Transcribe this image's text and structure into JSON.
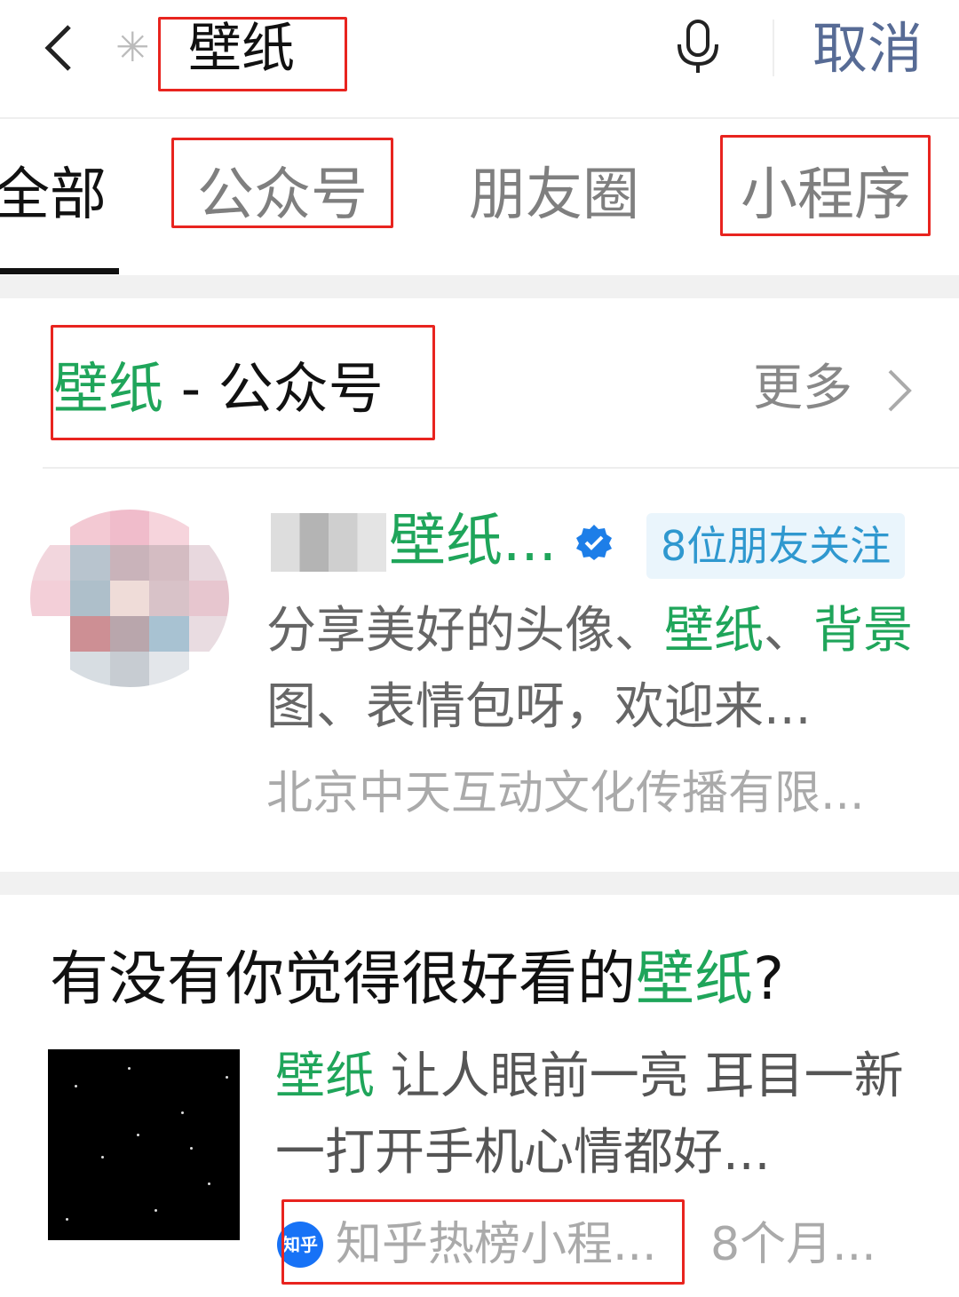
{
  "search_bar": {
    "back_icon": "chevron-left-icon",
    "scan_icon": "loading-spinner-icon",
    "query": "壁纸",
    "mic_icon": "microphone-icon",
    "cancel_label": "取消"
  },
  "tabs": [
    {
      "label": "全部",
      "active": true
    },
    {
      "label": "公众号",
      "active": false
    },
    {
      "label": "朋友圈",
      "active": false
    },
    {
      "label": "小程序",
      "active": false
    }
  ],
  "official_accounts": {
    "title_keyword": "壁纸",
    "title_rest": " - 公众号",
    "more_label": "更多",
    "account": {
      "name": "壁纸...",
      "verified_icon": "verified-badge-icon",
      "friends_badge": "8位朋友关注",
      "description_parts": [
        {
          "text": "分享美好的头像、",
          "highlight": false
        },
        {
          "text": "壁纸",
          "highlight": true
        },
        {
          "text": "、",
          "highlight": false
        },
        {
          "text": "背景",
          "highlight": true
        },
        {
          "text": "图、表情包呀，欢迎来...",
          "highlight": false
        }
      ],
      "company": "北京中天互动文化传播有限..."
    }
  },
  "article": {
    "title_prefix": "有没有你觉得很好看的",
    "title_keyword": "壁纸",
    "title_suffix": "?",
    "desc_keyword": "壁纸",
    "desc_rest": " 让人眼前一亮 耳目一新 一打开手机心情都好...",
    "source_logo_text": "知乎",
    "source": "知乎热榜小程...",
    "time": "8个月..."
  },
  "colors": {
    "highlight_green": "#1fa55a",
    "link_blue": "#576b95",
    "badge_blue": "#2f98cf",
    "annotation_red": "#e8241f"
  }
}
